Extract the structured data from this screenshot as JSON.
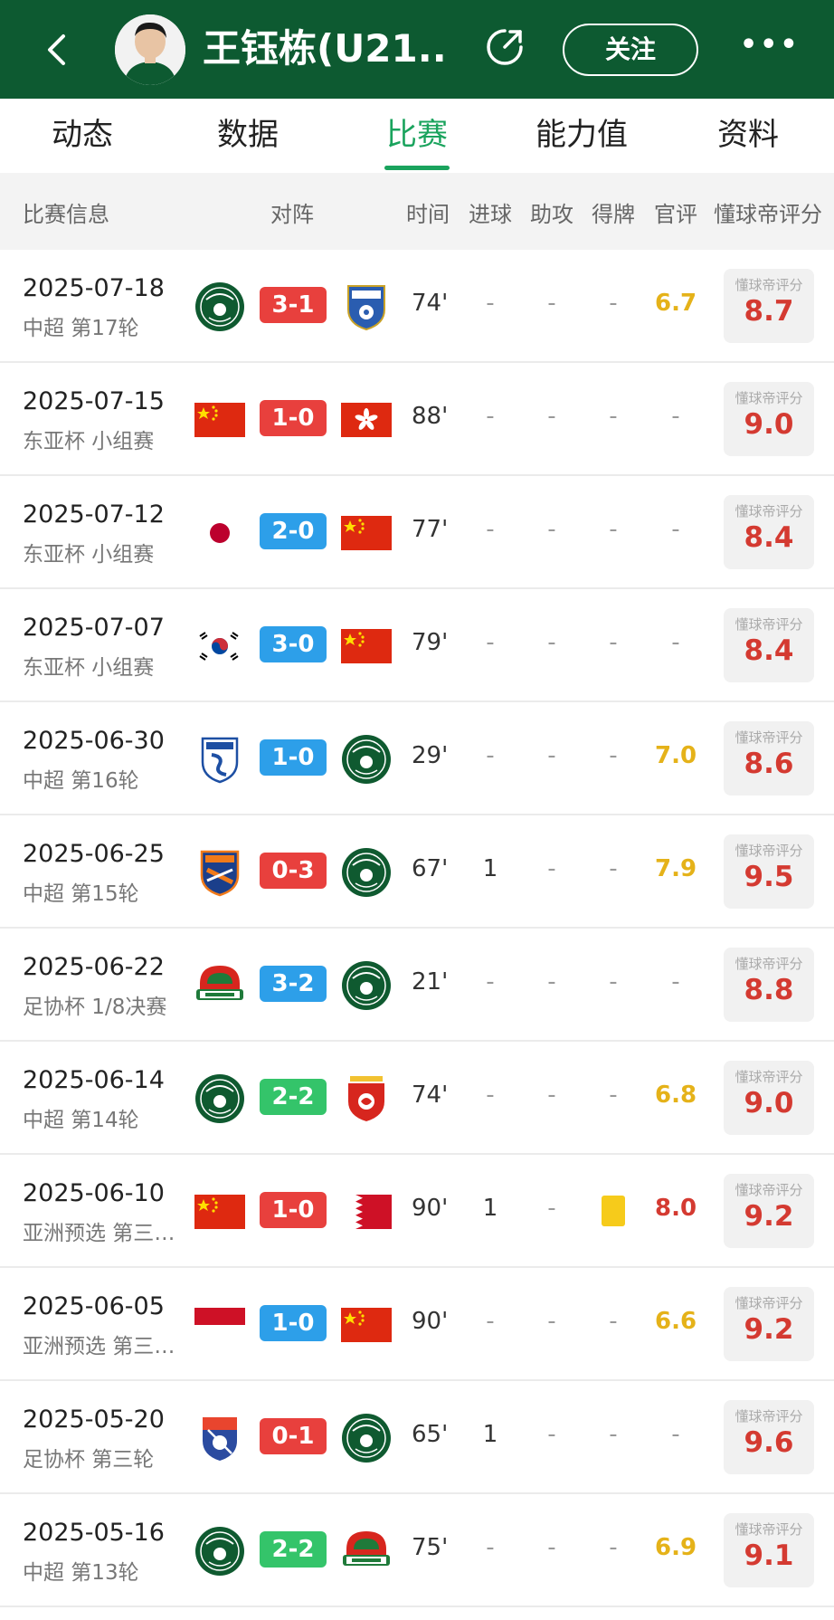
{
  "header": {
    "player_name": "王钰栋(U21...",
    "follow_label": "关注",
    "more_label": "•••",
    "bg_color": "#0d5a31"
  },
  "tabs": [
    {
      "label": "动态"
    },
    {
      "label": "数据"
    },
    {
      "label": "比赛",
      "active": true
    },
    {
      "label": "能力值"
    },
    {
      "label": "资料"
    }
  ],
  "columns": {
    "info": "比赛信息",
    "matchup": "对阵",
    "time": "时间",
    "goals": "进球",
    "assists": "助攻",
    "cards": "得牌",
    "official": "官评",
    "fan_rating": "懂球帝评分"
  },
  "rating_label": "懂球帝评分",
  "dash": "-",
  "matches": [
    {
      "date": "2025-07-18",
      "competition": "中超 第17轮",
      "home": "zhejiang-logo",
      "away": "yunnan-yukun-logo",
      "score": "3-1",
      "score_color": "win",
      "minutes": "74'",
      "goals": "-",
      "assists": "-",
      "cards": "-",
      "official": "6.7",
      "official_color": "yellow",
      "rating": "8.7"
    },
    {
      "date": "2025-07-15",
      "competition": "东亚杯 小组赛",
      "home": "china-flag",
      "away": "hong-kong-flag",
      "score": "1-0",
      "score_color": "win",
      "minutes": "88'",
      "goals": "-",
      "assists": "-",
      "cards": "-",
      "official": "-",
      "official_color": "dash",
      "rating": "9.0"
    },
    {
      "date": "2025-07-12",
      "competition": "东亚杯 小组赛",
      "home": "japan-flag",
      "away": "china-flag",
      "score": "2-0",
      "score_color": "lose",
      "minutes": "77'",
      "goals": "-",
      "assists": "-",
      "cards": "-",
      "official": "-",
      "official_color": "dash",
      "rating": "8.4"
    },
    {
      "date": "2025-07-07",
      "competition": "东亚杯 小组赛",
      "home": "korea-flag",
      "away": "china-flag",
      "score": "3-0",
      "score_color": "lose",
      "minutes": "79'",
      "goals": "-",
      "assists": "-",
      "cards": "-",
      "official": "-",
      "official_color": "dash",
      "rating": "8.4"
    },
    {
      "date": "2025-06-30",
      "competition": "中超 第16轮",
      "home": "dalian-logo",
      "away": "zhejiang-logo",
      "score": "1-0",
      "score_color": "lose",
      "minutes": "29'",
      "goals": "-",
      "assists": "-",
      "cards": "-",
      "official": "7.0",
      "official_color": "yellow",
      "rating": "8.6"
    },
    {
      "date": "2025-06-25",
      "competition": "中超 第15轮",
      "home": "qingdao-west-coast-logo",
      "away": "zhejiang-logo",
      "score": "0-3",
      "score_color": "win",
      "minutes": "67'",
      "goals": "1",
      "assists": "-",
      "cards": "-",
      "official": "7.9",
      "official_color": "yellow",
      "rating": "9.5"
    },
    {
      "date": "2025-06-22",
      "competition": "足协杯 1/8决赛",
      "home": "henan-logo",
      "away": "zhejiang-logo",
      "score": "3-2",
      "score_color": "lose",
      "minutes": "21'",
      "goals": "-",
      "assists": "-",
      "cards": "-",
      "official": "-",
      "official_color": "dash",
      "rating": "8.8"
    },
    {
      "date": "2025-06-14",
      "competition": "中超 第14轮",
      "home": "zhejiang-logo",
      "away": "shanghai-shenhua-logo",
      "score": "2-2",
      "score_color": "draw",
      "minutes": "74'",
      "goals": "-",
      "assists": "-",
      "cards": "-",
      "official": "6.8",
      "official_color": "yellow",
      "rating": "9.0"
    },
    {
      "date": "2025-06-10",
      "competition": "亚洲预选 第三阶段",
      "home": "china-flag",
      "away": "bahrain-flag",
      "score": "1-0",
      "score_color": "win",
      "minutes": "90'",
      "goals": "1",
      "assists": "-",
      "cards": "yellow-card",
      "official": "8.0",
      "official_color": "red",
      "rating": "9.2"
    },
    {
      "date": "2025-06-05",
      "competition": "亚洲预选 第三阶段",
      "home": "indonesia-flag",
      "away": "china-flag",
      "score": "1-0",
      "score_color": "lose",
      "minutes": "90'",
      "goals": "-",
      "assists": "-",
      "cards": "-",
      "official": "6.6",
      "official_color": "yellow",
      "rating": "9.2"
    },
    {
      "date": "2025-05-20",
      "competition": "足协杯 第三轮",
      "home": "shijiazhuang-logo",
      "away": "zhejiang-logo",
      "score": "0-1",
      "score_color": "win",
      "minutes": "65'",
      "goals": "1",
      "assists": "-",
      "cards": "-",
      "official": "-",
      "official_color": "dash",
      "rating": "9.6"
    },
    {
      "date": "2025-05-16",
      "competition": "中超 第13轮",
      "home": "zhejiang-logo",
      "away": "henan-logo",
      "score": "2-2",
      "score_color": "draw",
      "minutes": "75'",
      "goals": "-",
      "assists": "-",
      "cards": "-",
      "official": "6.9",
      "official_color": "yellow",
      "rating": "9.1"
    }
  ]
}
